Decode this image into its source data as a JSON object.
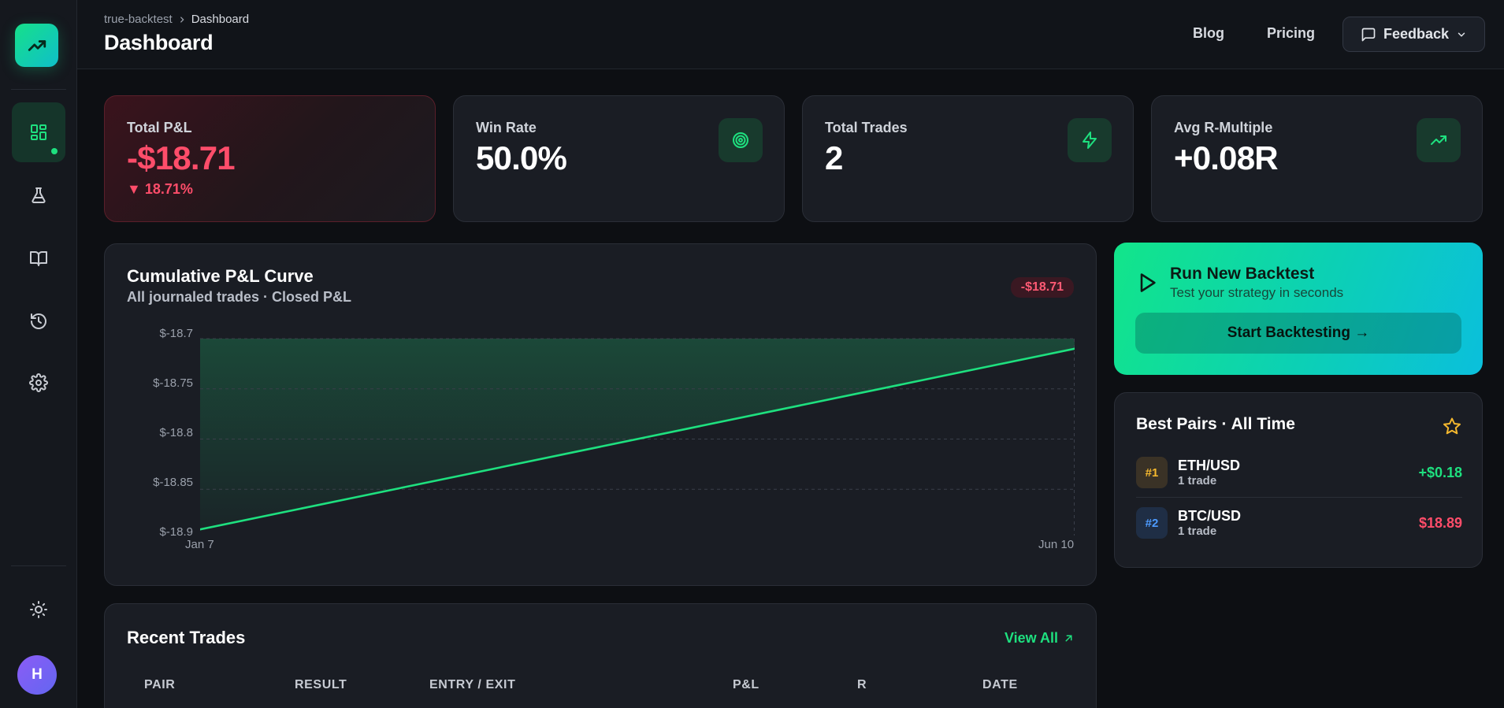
{
  "sidebar": {
    "logo_icon": "trending-up-icon",
    "items": [
      {
        "name": "dashboard",
        "icon": "layout-grid-icon",
        "active": true
      },
      {
        "name": "lab",
        "icon": "flask-icon",
        "active": false
      },
      {
        "name": "journal",
        "icon": "book-open-icon",
        "active": false
      },
      {
        "name": "history",
        "icon": "history-icon",
        "active": false
      },
      {
        "name": "settings",
        "icon": "gear-icon",
        "active": false
      }
    ],
    "theme_icon": "sun-icon",
    "avatar_initial": "H"
  },
  "header": {
    "breadcrumb": [
      "true-backtest",
      "Dashboard"
    ],
    "title": "Dashboard",
    "links": [
      "Blog",
      "Pricing"
    ],
    "feedback_label": "Feedback"
  },
  "stats": [
    {
      "label": "Total P&L",
      "value": "-$18.71",
      "change": "▼ 18.71%"
    },
    {
      "label": "Win Rate",
      "value": "50.0%",
      "icon": "target-icon"
    },
    {
      "label": "Total Trades",
      "value": "2",
      "icon": "zap-icon"
    },
    {
      "label": "Avg R-Multiple",
      "value": "+0.08R",
      "icon": "trending-up-icon"
    }
  ],
  "chart_card": {
    "title": "Cumulative P&L Curve",
    "subtitle": "All journaled trades · Closed P&L",
    "badge": "-$18.71"
  },
  "chart_data": {
    "type": "area",
    "title": "Cumulative P&L Curve",
    "x": [
      "Jan 7",
      "Jun 10"
    ],
    "y": [
      -18.89,
      -18.71
    ],
    "y_ticks": [
      "$-18.7",
      "$-18.75",
      "$-18.8",
      "$-18.85",
      "$-18.9"
    ],
    "x_ticks": [
      "Jan 7",
      "Jun 10"
    ],
    "ylim": [
      -18.9,
      -18.7
    ],
    "grid": true,
    "color": "#1ee07f"
  },
  "backtest": {
    "title": "Run New Backtest",
    "subtitle": "Test your strategy in seconds",
    "button": "Start Backtesting →"
  },
  "best_pairs": {
    "title": "Best Pairs · All Time",
    "icon": "star-icon",
    "pairs": [
      {
        "rank": "#1",
        "pair": "ETH/USD",
        "count": "1 trade",
        "value": "+$0.18"
      },
      {
        "rank": "#2",
        "pair": "BTC/USD",
        "count": "1 trade",
        "value": "$18.89"
      }
    ]
  },
  "recent_trades": {
    "title": "Recent Trades",
    "view_all": "View All",
    "columns": [
      "PAIR",
      "RESULT",
      "ENTRY / EXIT",
      "P&L",
      "R",
      "DATE"
    ]
  },
  "colors": {
    "accent": "#1ee07f",
    "negative": "#ff4d6a",
    "background": "#0d0f13",
    "card": "#1a1d24"
  }
}
